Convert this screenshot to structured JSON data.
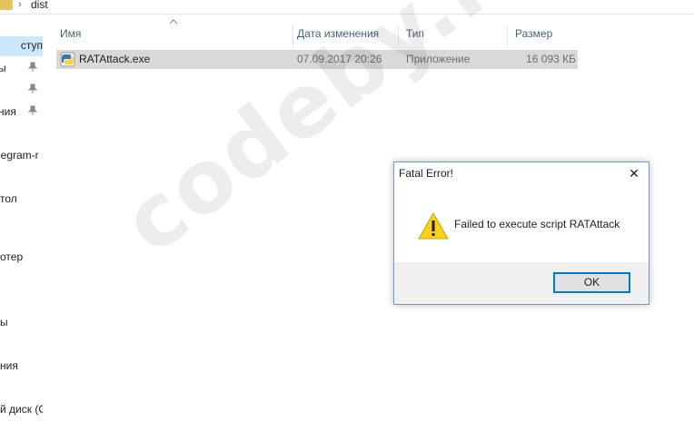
{
  "breadcrumb": {
    "current": "dist"
  },
  "nav": {
    "items": [
      {
        "label": "ступ",
        "selected": true
      },
      {
        "label": "ы",
        "pinned": true
      },
      {
        "label": "",
        "pinned": true
      },
      {
        "label": "ния",
        "pinned": true
      },
      {
        "label": "legram-r"
      },
      {
        "label": "тол"
      },
      {
        "label": "отер"
      },
      {
        "label": "ы"
      },
      {
        "label": "ния"
      },
      {
        "label": "й диск (C"
      }
    ]
  },
  "columns": {
    "name": "Имя",
    "date": "Дата изменения",
    "type": "Тип",
    "size": "Размер"
  },
  "files": [
    {
      "name": "RATAttack.exe",
      "date": "07.09.2017 20:26",
      "type": "Приложение",
      "size": "16 093 КБ"
    }
  ],
  "watermark": "codeby.net",
  "dialog": {
    "title": "Fatal Error!",
    "close": "✕",
    "message": "Failed to execute script RATAttack",
    "ok_label": "OK"
  },
  "colors": {
    "accent": "#0078d7",
    "selection": "#cce8ff",
    "row_selected": "#d9d9d9",
    "warning": "#f7d21c"
  }
}
